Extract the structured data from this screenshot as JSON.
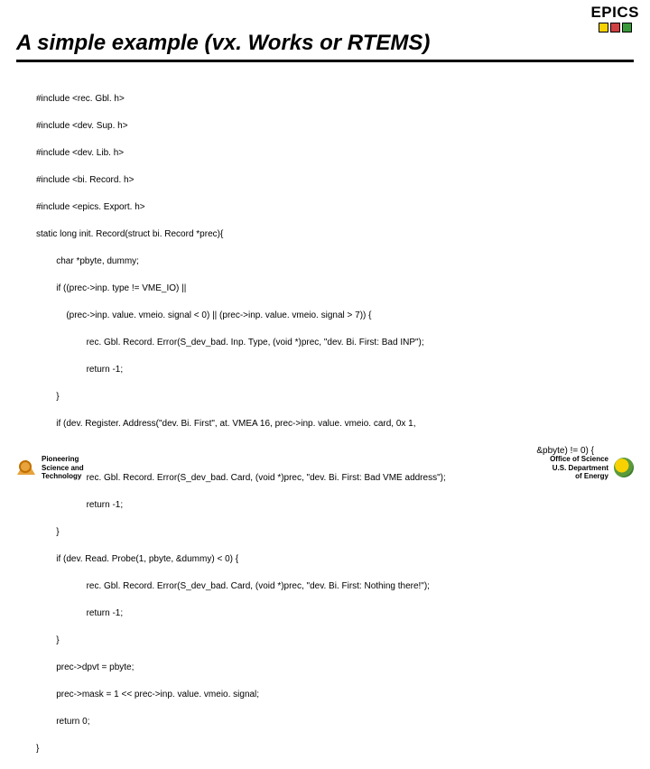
{
  "header": {
    "logo_text": "EPICS",
    "title": "A simple example (vx. Works or RTEMS)"
  },
  "code": {
    "lines": [
      "#include <rec. Gbl. h>",
      "#include <dev. Sup. h>",
      "#include <dev. Lib. h>",
      "#include <bi. Record. h>",
      "#include <epics. Export. h>",
      "static long init. Record(struct bi. Record *prec){",
      "        char *pbyte, dummy;",
      "        if ((prec->inp. type != VME_IO) ||",
      "            (prec->inp. value. vmeio. signal < 0) || (prec->inp. value. vmeio. signal > 7)) {",
      "                    rec. Gbl. Record. Error(S_dev_bad. Inp. Type, (void *)prec, \"dev. Bi. First: Bad INP\");",
      "                    return -1;",
      "        }",
      "        if (dev. Register. Address(\"dev. Bi. First\", at. VMEA 16, prec->inp. value. vmeio. card, 0x 1,"
    ],
    "right_fragment": "&pbyte) != 0) {",
    "lines2": [
      "                    rec. Gbl. Record. Error(S_dev_bad. Card, (void *)prec, \"dev. Bi. First: Bad VME address\");",
      "                    return -1;",
      "        }",
      "        if (dev. Read. Probe(1, pbyte, &dummy) < 0) {",
      "                    rec. Gbl. Record. Error(S_dev_bad. Card, (void *)prec, \"dev. Bi. First: Nothing there!\");",
      "                    return -1;",
      "        }",
      "        prec->dpvt = pbyte;",
      "        prec->mask = 1 << prec->inp. value. vmeio. signal;",
      "        return 0;",
      "}"
    ]
  },
  "footer": {
    "left_line1": "Pioneering",
    "left_line2": "Science and",
    "left_line3": "Technology",
    "right_line1": "Office of Science",
    "right_line2": "U.S. Department",
    "right_line3": "of Energy"
  }
}
